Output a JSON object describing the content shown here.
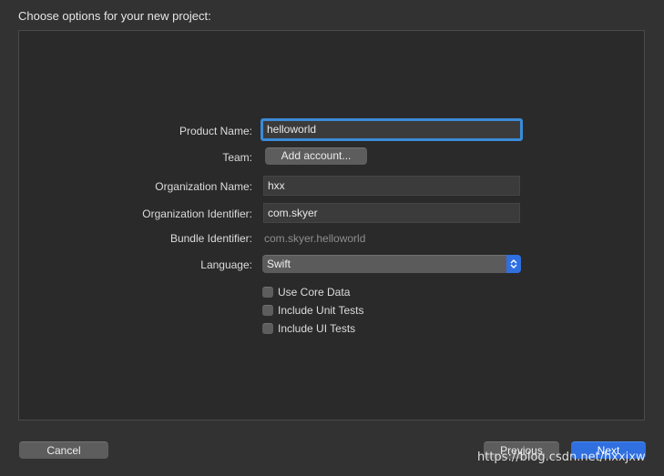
{
  "dialog": {
    "title": "Choose options for your new project:"
  },
  "form": {
    "product_name": {
      "label": "Product Name:",
      "value": "helloworld"
    },
    "team": {
      "label": "Team:",
      "button_label": "Add account..."
    },
    "organization_name": {
      "label": "Organization Name:",
      "value": "hxx"
    },
    "organization_identifier": {
      "label": "Organization Identifier:",
      "value": "com.skyer"
    },
    "bundle_identifier": {
      "label": "Bundle Identifier:",
      "value": "com.skyer.helloworld"
    },
    "language": {
      "label": "Language:",
      "selected": "Swift"
    },
    "checkboxes": [
      {
        "label": "Use Core Data",
        "checked": false
      },
      {
        "label": "Include Unit Tests",
        "checked": false
      },
      {
        "label": "Include UI Tests",
        "checked": false
      }
    ]
  },
  "footer": {
    "cancel_label": "Cancel",
    "previous_label": "Previous",
    "next_label": "Next"
  },
  "watermark": "https://blog.csdn.net/hxxjxw",
  "colors": {
    "accent": "#2f6fe0",
    "focus_ring": "#3b8bd6",
    "background": "#323233",
    "panel": "#2a2a2b"
  }
}
